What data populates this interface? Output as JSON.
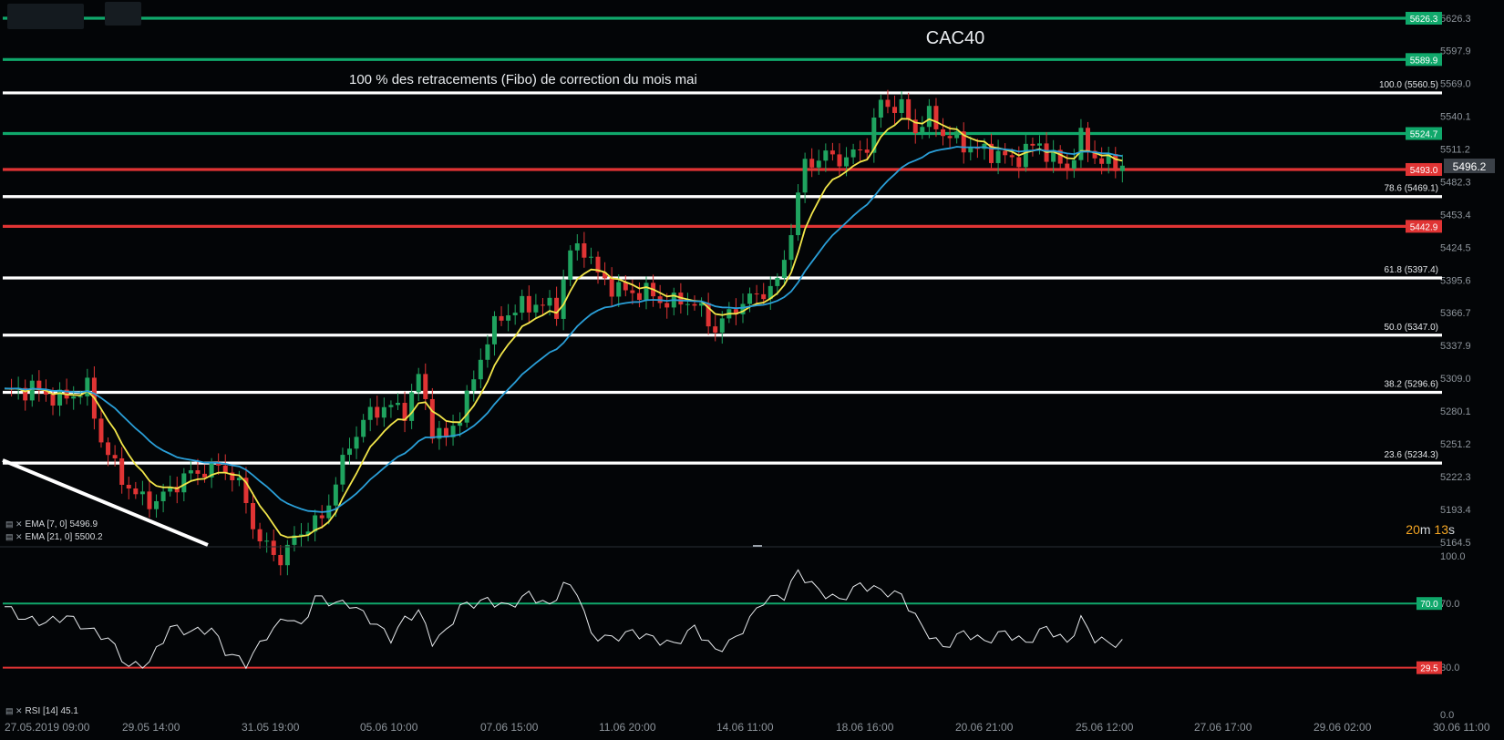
{
  "chart_data": [
    {
      "type": "candlestick",
      "title": "CAC40",
      "annotation": "100 % des retracements (Fibo) de correction du mois mai",
      "y_tick_labels": [
        "5626.3",
        "5597.9",
        "5569.0",
        "5540.1",
        "5511.2",
        "5482.3",
        "5453.4",
        "5424.5",
        "5395.6",
        "5366.7",
        "5337.9",
        "5309.0",
        "5280.1",
        "5251.2",
        "5222.3",
        "5193.4",
        "5164.5"
      ],
      "ylim": [
        5164.5,
        5626.3
      ],
      "x_tick_labels": [
        "27.05.2019  09:00",
        "29.05  14:00",
        "31.05  19:00",
        "05.06  10:00",
        "07.06  15:00",
        "11.06  20:00",
        "14.06  11:00",
        "18.06  16:00",
        "20.06  21:00",
        "25.06  12:00",
        "27.06  17:00",
        "29.06  02:00",
        "30.06  11:00"
      ],
      "last_price": "5496.2",
      "fib_levels": [
        {
          "label": "100.0 (5560.5)",
          "value": 5560.5
        },
        {
          "label": "78.6 (5469.1)",
          "value": 5469.1
        },
        {
          "label": "61.8 (5397.4)",
          "value": 5397.4
        },
        {
          "label": "50.0 (5347.0)",
          "value": 5347.0
        },
        {
          "label": "38.2 (5296.6)",
          "value": 5296.6
        },
        {
          "label": "23.6 (5234.3)",
          "value": 5234.3
        }
      ],
      "horizontal_levels": [
        {
          "label": "5626.3",
          "value": 5626.3,
          "color": "#10a86b"
        },
        {
          "label": "5589.9",
          "value": 5589.9,
          "color": "#10a86b"
        },
        {
          "label": "5524.7",
          "value": 5524.7,
          "color": "#10a86b"
        },
        {
          "label": "5493.0",
          "value": 5493.0,
          "color": "#e03434"
        },
        {
          "label": "5442.9",
          "value": 5442.9,
          "color": "#e03434"
        }
      ],
      "indicators": [
        {
          "label": "EMA  [7,  0]  5496.9",
          "color": "#f2e64a"
        },
        {
          "label": "EMA  [21,  0]  5500.2",
          "color": "#2a9fd8"
        }
      ],
      "countdown": {
        "num1": "20",
        "unit1": "m",
        "num2": "13",
        "unit2": "s"
      },
      "close_path": [
        [
          0,
          5296
        ],
        [
          4,
          5300
        ],
        [
          8,
          5290
        ],
        [
          12,
          5300
        ],
        [
          14,
          5255
        ],
        [
          16,
          5230
        ],
        [
          19,
          5205
        ],
        [
          22,
          5200
        ],
        [
          26,
          5222
        ],
        [
          29,
          5228
        ],
        [
          32,
          5230
        ],
        [
          34,
          5215
        ],
        [
          37,
          5165
        ],
        [
          40,
          5150
        ],
        [
          43,
          5175
        ],
        [
          46,
          5185
        ],
        [
          50,
          5250
        ],
        [
          52,
          5272
        ],
        [
          55,
          5285
        ],
        [
          58,
          5280
        ],
        [
          60,
          5310
        ],
        [
          62,
          5265
        ],
        [
          64,
          5255
        ],
        [
          67,
          5290
        ],
        [
          70,
          5345
        ],
        [
          72,
          5363
        ],
        [
          74,
          5370
        ],
        [
          77,
          5375
        ],
        [
          80,
          5370
        ],
        [
          82,
          5420
        ],
        [
          84,
          5425
        ],
        [
          86,
          5400
        ],
        [
          88,
          5390
        ],
        [
          90,
          5385
        ],
        [
          93,
          5385
        ],
        [
          96,
          5375
        ],
        [
          99,
          5378
        ],
        [
          101,
          5368
        ],
        [
          103,
          5352
        ],
        [
          106,
          5372
        ],
        [
          109,
          5382
        ],
        [
          112,
          5392
        ],
        [
          114,
          5440
        ],
        [
          116,
          5498
        ],
        [
          119,
          5505
        ],
        [
          122,
          5502
        ],
        [
          125,
          5515
        ],
        [
          127,
          5552
        ],
        [
          130,
          5547
        ],
        [
          132,
          5528
        ],
        [
          134,
          5540
        ],
        [
          136,
          5525
        ],
        [
          138,
          5518
        ],
        [
          141,
          5510
        ],
        [
          144,
          5507
        ],
        [
          146,
          5500
        ],
        [
          148,
          5510
        ],
        [
          150,
          5515
        ],
        [
          152,
          5502
        ],
        [
          154,
          5495
        ],
        [
          156,
          5520
        ],
        [
          158,
          5505
        ],
        [
          160,
          5497
        ],
        [
          162,
          5498
        ]
      ]
    },
    {
      "type": "line",
      "title": "",
      "indicator_label": "RSI  [14]  45.1",
      "y_tick_labels": [
        "100.0",
        "70.0",
        "30.0",
        "0.0"
      ],
      "ylim": [
        0,
        100
      ],
      "levels": [
        {
          "label": "70.0",
          "value": 70.0,
          "color": "#10a86b"
        },
        {
          "label": "29.5",
          "value": 29.5,
          "color": "#e03434"
        }
      ],
      "rsi_path": [
        [
          0,
          68
        ],
        [
          3,
          60
        ],
        [
          6,
          58
        ],
        [
          9,
          62
        ],
        [
          12,
          54
        ],
        [
          15,
          48
        ],
        [
          18,
          30
        ],
        [
          21,
          33
        ],
        [
          24,
          55
        ],
        [
          27,
          52
        ],
        [
          30,
          54
        ],
        [
          32,
          40
        ],
        [
          35,
          32
        ],
        [
          38,
          50
        ],
        [
          41,
          62
        ],
        [
          43,
          55
        ],
        [
          45,
          74
        ],
        [
          48,
          70
        ],
        [
          50,
          70
        ],
        [
          53,
          60
        ],
        [
          56,
          48
        ],
        [
          58,
          60
        ],
        [
          60,
          65
        ],
        [
          62,
          46
        ],
        [
          64,
          52
        ],
        [
          66,
          68
        ],
        [
          70,
          72
        ],
        [
          73,
          68
        ],
        [
          76,
          76
        ],
        [
          79,
          68
        ],
        [
          81,
          82
        ],
        [
          83,
          78
        ],
        [
          85,
          50
        ],
        [
          88,
          48
        ],
        [
          91,
          52
        ],
        [
          94,
          48
        ],
        [
          97,
          44
        ],
        [
          100,
          55
        ],
        [
          103,
          40
        ],
        [
          106,
          48
        ],
        [
          110,
          72
        ],
        [
          113,
          75
        ],
        [
          115,
          90
        ],
        [
          118,
          78
        ],
        [
          121,
          72
        ],
        [
          124,
          82
        ],
        [
          127,
          78
        ],
        [
          130,
          75
        ],
        [
          133,
          55
        ],
        [
          136,
          42
        ],
        [
          139,
          52
        ],
        [
          142,
          46
        ],
        [
          145,
          52
        ],
        [
          148,
          45
        ],
        [
          151,
          55
        ],
        [
          154,
          45
        ],
        [
          156,
          60
        ],
        [
          158,
          48
        ],
        [
          160,
          45
        ],
        [
          162,
          45.1
        ]
      ]
    }
  ]
}
